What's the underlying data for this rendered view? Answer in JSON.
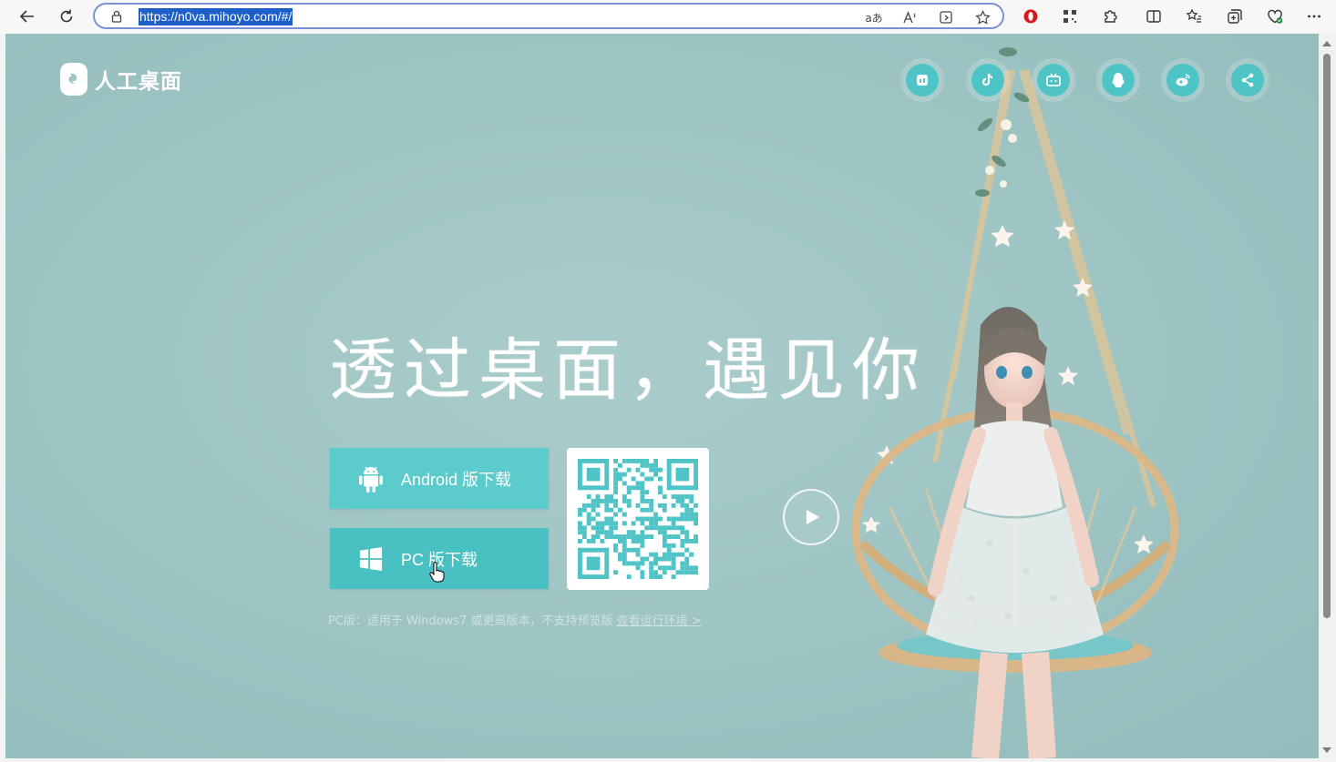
{
  "browser": {
    "url": "https://n0va.mihoyo.com/#/",
    "read_aloud_label": "A",
    "translate_label": "aあ"
  },
  "page": {
    "logo_text": "人工桌面",
    "headline": "透过桌面，遇见你",
    "android_button": "Android 版下载",
    "pc_button": "PC 版下载",
    "note_text": "PC版：适用于 Windows7 或更高版本，不支持预览版",
    "note_link": "查看运行环境 >",
    "social_icons": [
      "mihoyo-icon",
      "douyin-icon",
      "bilibili-icon",
      "qq-icon",
      "weibo-icon",
      "share-icon"
    ],
    "colors": {
      "accent": "#4fc4c6",
      "background": "#a0c6c5"
    }
  }
}
